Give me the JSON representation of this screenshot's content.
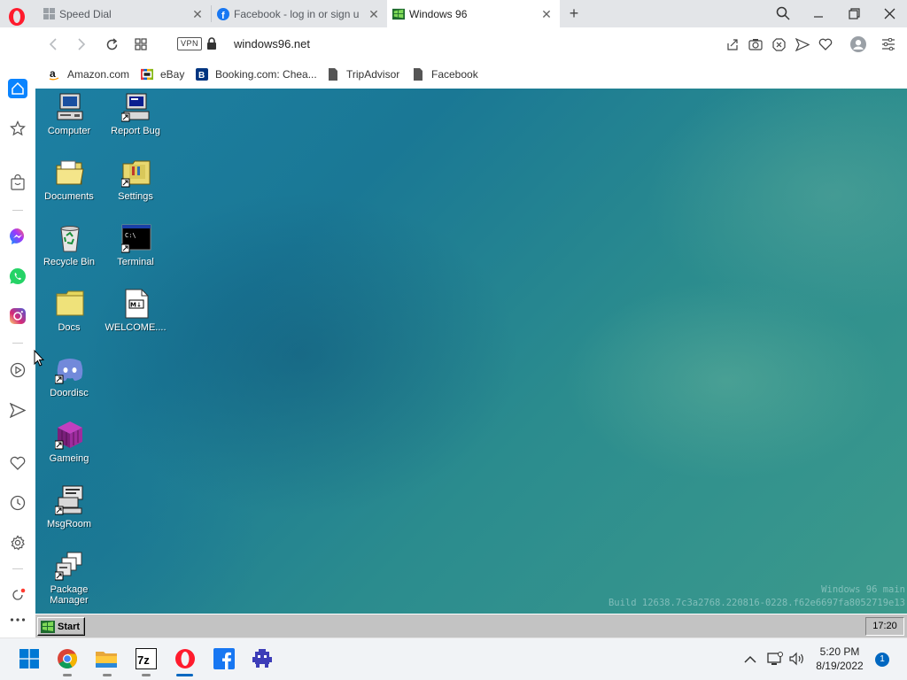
{
  "browser": {
    "tabs": [
      {
        "title": "Speed Dial",
        "icon": "speed-dial-icon"
      },
      {
        "title": "Facebook - log in or sign u",
        "icon": "facebook-icon"
      },
      {
        "title": "Windows 96",
        "icon": "windows96-icon",
        "active": true
      }
    ],
    "url": "windows96.net",
    "vpn_label": "VPN",
    "bookmarks": [
      {
        "label": "Amazon.com",
        "icon": "amazon-icon"
      },
      {
        "label": "eBay",
        "icon": "ebay-icon"
      },
      {
        "label": "Booking.com: Chea...",
        "icon": "booking-icon"
      },
      {
        "label": "TripAdvisor",
        "icon": "page-icon"
      },
      {
        "label": "Facebook",
        "icon": "page-icon"
      }
    ]
  },
  "desktop": {
    "icons": [
      {
        "label": "Computer",
        "icon": "computer-icon"
      },
      {
        "label": "Report Bug",
        "icon": "report-bug-icon"
      },
      {
        "label": "Documents",
        "icon": "documents-folder-icon"
      },
      {
        "label": "Settings",
        "icon": "settings-folder-icon"
      },
      {
        "label": "Recycle Bin",
        "icon": "recycle-bin-icon"
      },
      {
        "label": "Terminal",
        "icon": "terminal-icon"
      },
      {
        "label": "Docs",
        "icon": "folder-icon"
      },
      {
        "label": "WELCOME....",
        "icon": "markdown-file-icon"
      },
      {
        "label": "Doordisc",
        "icon": "discord-icon"
      },
      {
        "label": "Gameing",
        "icon": "cube-icon"
      },
      {
        "label": "MsgRoom",
        "icon": "msgroom-icon"
      },
      {
        "label": "Package Manager",
        "icon": "package-manager-icon"
      }
    ],
    "build_line1": "Windows 96 main",
    "build_line2": "Build 12638.7c3a2768.220816-0228.f62e6697fa8052719e13"
  },
  "win96_taskbar": {
    "start_label": "Start",
    "clock": "17:20"
  },
  "os_taskbar": {
    "time": "5:20 PM",
    "date": "8/19/2022",
    "notification_count": "1"
  },
  "colors": {
    "opera_red": "#ff1b2d",
    "accent_blue": "#0a84ff",
    "desktop_teal": "#1d7fa3"
  }
}
